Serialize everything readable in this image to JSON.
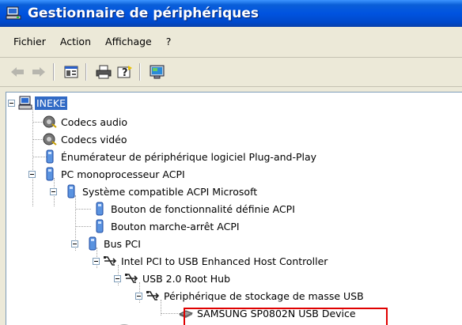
{
  "window": {
    "title": "Gestionnaire de périphériques",
    "icon": "device-manager-icon"
  },
  "menu": [
    "Fichier",
    "Action",
    "Affichage",
    "?"
  ],
  "toolbar": {
    "buttons": [
      "back-arrow-icon",
      "forward-arrow-icon",
      "properties-icon",
      "print-icon",
      "help-icon",
      "scan-hardware-icon"
    ]
  },
  "tree": [
    {
      "label": "INEKE",
      "icon": "computer-icon",
      "level": 0,
      "expanded": true,
      "selected": true
    },
    {
      "label": "Codecs audio",
      "icon": "audio-codec-icon",
      "level": 1
    },
    {
      "label": "Codecs vidéo",
      "icon": "video-codec-icon",
      "level": 1
    },
    {
      "label": "Énumérateur de périphérique logiciel Plug-and-Play",
      "icon": "device-icon",
      "level": 1
    },
    {
      "label": "PC monoprocesseur ACPI",
      "icon": "device-icon",
      "level": 1,
      "expanded": true
    },
    {
      "label": "Système compatible ACPI Microsoft",
      "icon": "device-icon",
      "level": 2,
      "expanded": true
    },
    {
      "label": "Bouton de fonctionnalité définie ACPI",
      "icon": "device-icon",
      "level": 3
    },
    {
      "label": "Bouton marche-arrêt ACPI",
      "icon": "device-icon",
      "level": 3
    },
    {
      "label": "Bus PCI",
      "icon": "device-icon",
      "level": 3,
      "expanded": true
    },
    {
      "label": "Intel PCI to USB Enhanced Host Controller",
      "icon": "usb-icon",
      "level": 4,
      "expanded": true
    },
    {
      "label": "USB 2.0 Root Hub",
      "icon": "usb-icon",
      "level": 5,
      "expanded": true
    },
    {
      "label": "Périphérique de stockage de masse USB",
      "icon": "usb-icon",
      "level": 6,
      "expanded": true
    },
    {
      "label": "SAMSUNG SP0802N USB Device",
      "icon": "disk-drive-icon",
      "level": 7,
      "highlighted": true
    }
  ]
}
